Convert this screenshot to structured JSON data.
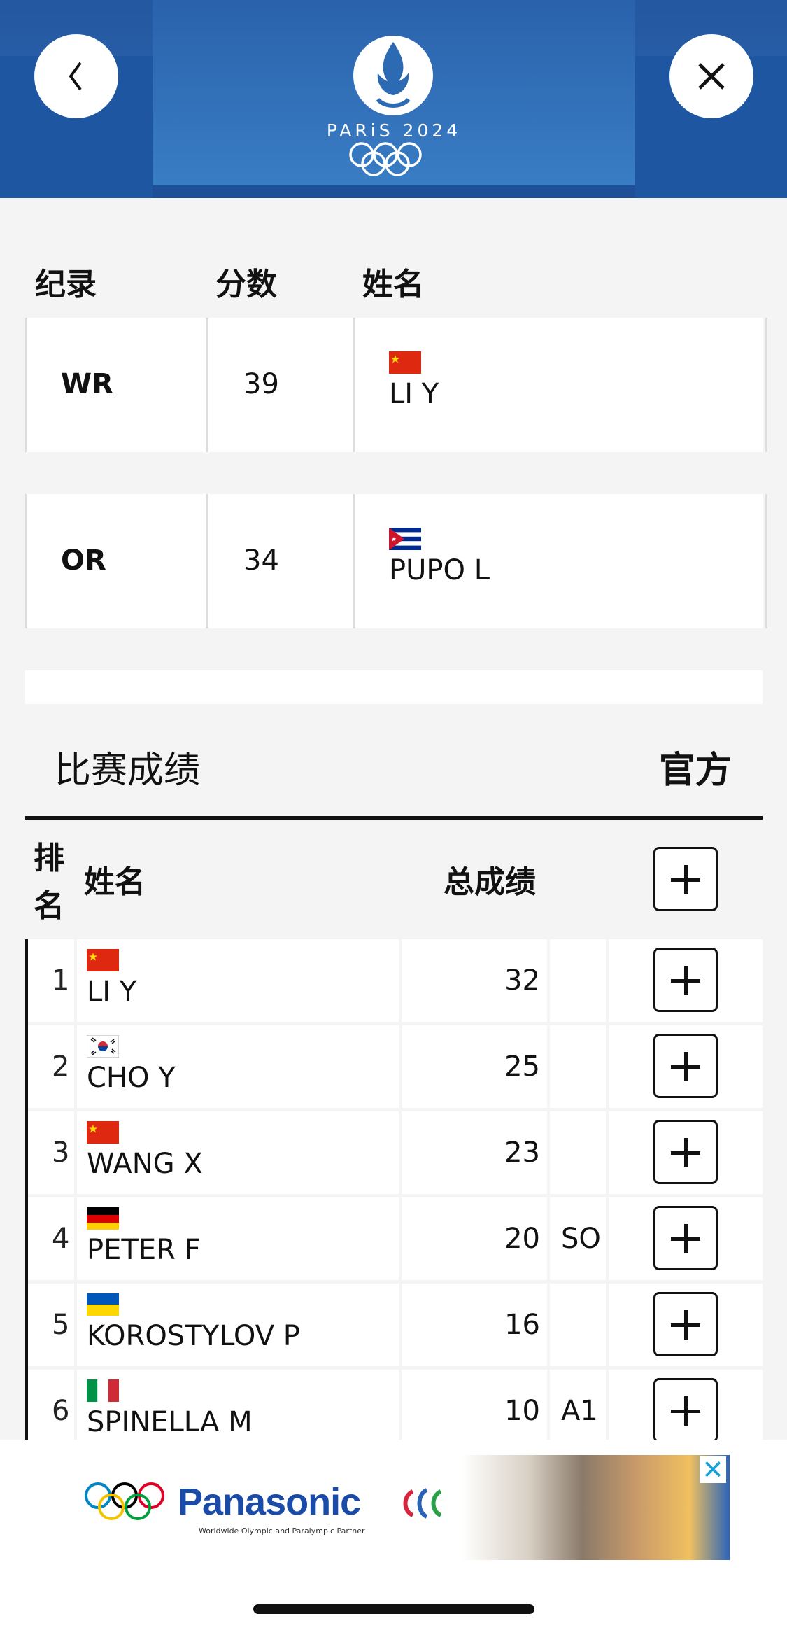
{
  "header": {
    "logo_text": "PARiS 2024",
    "back_icon": "chevron-left-icon",
    "close_icon": "close-icon"
  },
  "records": {
    "headers": {
      "record": "纪录",
      "score": "分数",
      "name": "姓名"
    },
    "rows": [
      {
        "code": "WR",
        "score": "39",
        "name": "LI Y",
        "country": "China"
      },
      {
        "code": "OR",
        "score": "34",
        "name": "PUPO L",
        "country": "Cuba"
      }
    ]
  },
  "results": {
    "title": "比赛成绩",
    "status": "官方",
    "headers": {
      "rank_line1": "排",
      "rank_line2": "名",
      "name": "姓名",
      "total": "总成绩"
    },
    "rows": [
      {
        "rank": "1",
        "name": "LI Y",
        "score": "32",
        "note": "",
        "country": "China"
      },
      {
        "rank": "2",
        "name": "CHO Y",
        "score": "25",
        "note": "",
        "country": "Korea"
      },
      {
        "rank": "3",
        "name": "WANG X",
        "score": "23",
        "note": "",
        "country": "China"
      },
      {
        "rank": "4",
        "name": "PETER F",
        "score": "20",
        "note": "SO",
        "country": "Germany"
      },
      {
        "rank": "5",
        "name": "KOROSTYLOV P",
        "score": "16",
        "note": "",
        "country": "Ukraine"
      },
      {
        "rank": "6",
        "name": "SPINELLA M",
        "score": "10",
        "note": "A1",
        "country": "Italy"
      }
    ]
  },
  "ad": {
    "brand": "Panasonic",
    "subtitle": "Worldwide Olympic and Paralympic Partner",
    "close_label": "✕"
  },
  "colors": {
    "header_blue": "#2c6ab4",
    "accent_dark": "#111111"
  }
}
